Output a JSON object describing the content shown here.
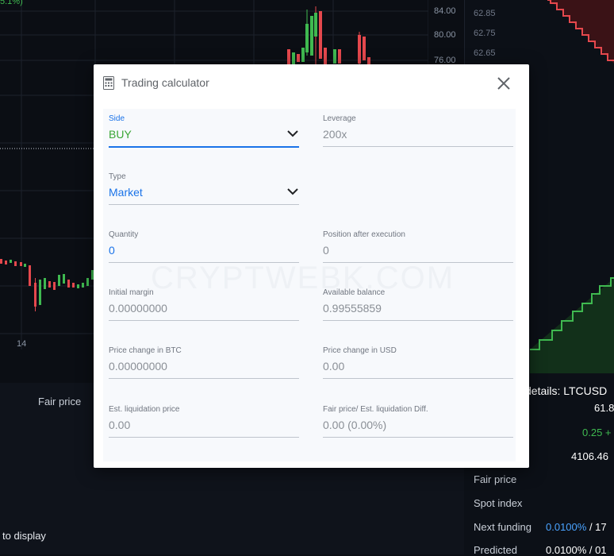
{
  "background": {
    "price_ticks": [
      "84.00",
      "80.00",
      "76.00"
    ],
    "orderbook_prices": [
      "62.85",
      "62.75",
      "62.65"
    ],
    "time_tick": "14",
    "fragment_top": "5.1%)",
    "fair_price_label": "Fair price",
    "nothing_label": "to display",
    "details_title": "details: LTCUSD",
    "details_values": {
      "v1": "61.8",
      "v2": "0.25 +",
      "v3": "4106.46"
    },
    "rows": [
      {
        "label": "Fair price",
        "value": ""
      },
      {
        "label": "Spot index",
        "value": ""
      },
      {
        "label": "Next funding",
        "value_blue": "0.0100%",
        "value_rest": " / 17"
      },
      {
        "label": "Predicted",
        "value_blue": "",
        "value_rest": "0.0100% / 01"
      }
    ],
    "watermark": "CRYPTWEBK.COM"
  },
  "modal": {
    "title": "Trading calculator",
    "fields": {
      "side": {
        "label": "Side",
        "value": "BUY"
      },
      "leverage": {
        "label": "Leverage",
        "value": "200x"
      },
      "type": {
        "label": "Type",
        "value": "Market"
      },
      "quantity": {
        "label": "Quantity",
        "value": "0"
      },
      "position_after": {
        "label": "Position after execution",
        "value": "0"
      },
      "initial_margin": {
        "label": "Initial margin",
        "value": "0.00000000"
      },
      "available_balance": {
        "label": "Available balance",
        "value": "0.99555859"
      },
      "price_change_btc": {
        "label": "Price change in BTC",
        "value": "0.00000000"
      },
      "price_change_usd": {
        "label": "Price change in USD",
        "value": "0.00"
      },
      "est_liq_price": {
        "label": "Est. liquidation price",
        "value": "0.00"
      },
      "fair_liq_diff": {
        "label": "Fair price/ Est. liquidation Diff.",
        "value": "0.00 (0.00%)"
      }
    }
  },
  "colors": {
    "buy_green": "#3aa635",
    "accent_blue": "#1a73e8",
    "candle_up": "#3fb950",
    "candle_down": "#e5484d"
  },
  "icons": {
    "calculator": "calculator-icon",
    "close": "close-icon",
    "chevron": "chevron-down-icon"
  }
}
